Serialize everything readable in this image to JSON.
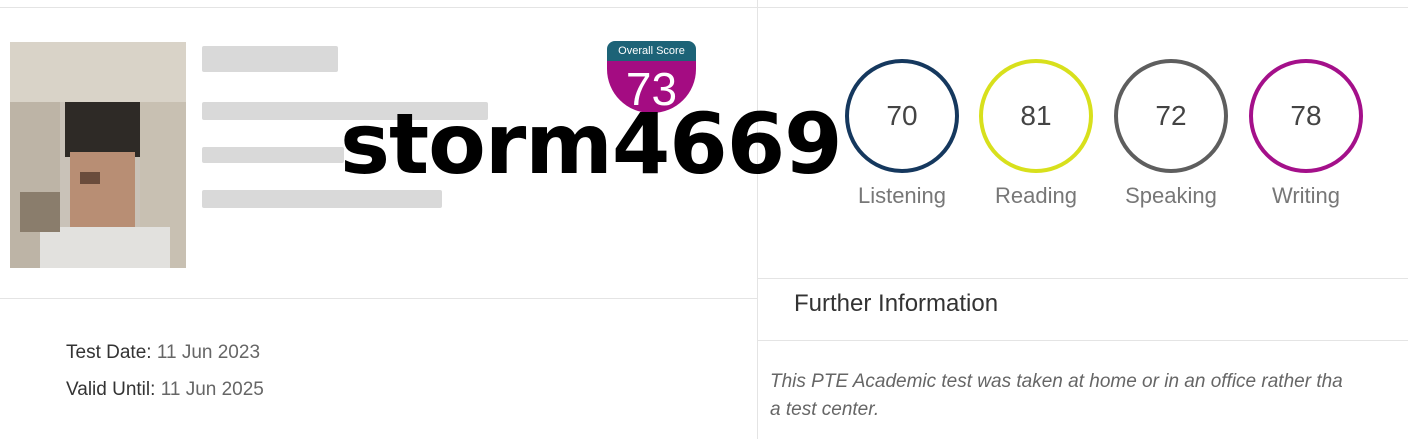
{
  "watermark": "storm4669",
  "overall": {
    "label": "Overall Score",
    "score": "73",
    "header_color": "#1d6377",
    "color": "#a40c82"
  },
  "skills": [
    {
      "name": "Listening",
      "score": "70",
      "color": "#15385e"
    },
    {
      "name": "Reading",
      "score": "81",
      "color": "#d8e01c"
    },
    {
      "name": "Speaking",
      "score": "72",
      "color": "#5e5e5e"
    },
    {
      "name": "Writing",
      "score": "78",
      "color": "#a4108a"
    }
  ],
  "further": {
    "title": "Further Information",
    "lines": [
      "This PTE Academic test was taken at home or in an office rather tha",
      "a test center."
    ]
  },
  "test_date": {
    "label": "Test Date:",
    "value": "11 Jun 2023"
  },
  "valid_until": {
    "label": "Valid Until:",
    "value": "11 Jun 2025"
  }
}
